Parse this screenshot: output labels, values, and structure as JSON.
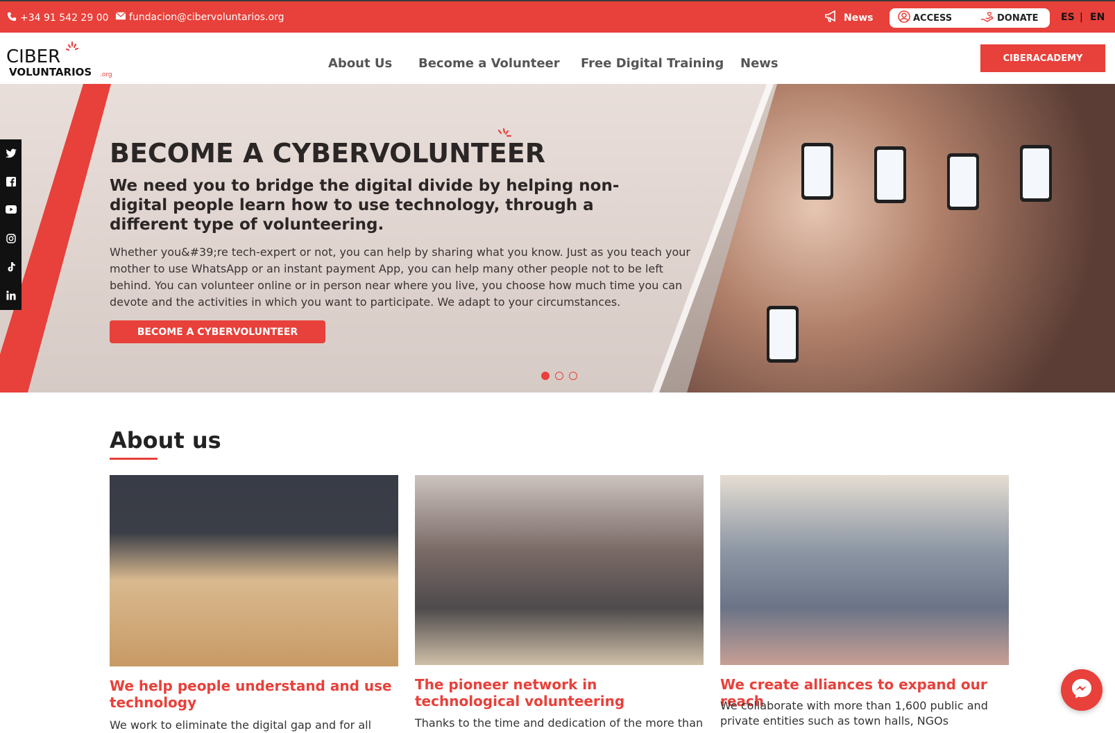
{
  "topbar": {
    "phone": "+34 91 542 29 00",
    "email": "fundacion@cibervoluntarios.org",
    "news": "News",
    "access": "ACCESS",
    "donate": "DONATE",
    "lang_es": "ES",
    "lang_sep": "|",
    "lang_en": "EN"
  },
  "logo": {
    "line1": "CIBER",
    "line2": "VOLUNTARIOS",
    "suffix": ".org"
  },
  "nav": {
    "about": "About Us",
    "volunteer": "Become a Volunteer",
    "training": "Free Digital Training",
    "news": "News",
    "academy": "CIBERACADEMY"
  },
  "hero": {
    "title": "BECOME A CYBERVOLUNTEER",
    "subtitle": "We need you to bridge the digital divide by helping non-digital people learn how to use technology, through a different type of volunteering.",
    "body": "Whether you&#39;re tech-expert or not, you can help by sharing what you know. Just as you teach your mother to use WhatsApp or an instant payment App, you can help many other people not to be left behind. You can volunteer online or in person near where you live, you choose how much time you can devote and the activities in which you want to participate. We adapt to your circumstances.",
    "button": "BECOME A CYBERVOLUNTEER",
    "slides": 3,
    "active_slide": 1
  },
  "social": [
    "twitter-icon",
    "facebook-icon",
    "youtube-icon",
    "instagram-icon",
    "tiktok-icon",
    "linkedin-icon"
  ],
  "about": {
    "title": "About us",
    "cards": [
      {
        "title": "We help people understand and use technology",
        "text": "We work to eliminate the digital gap and for all"
      },
      {
        "title": "The pioneer network in technological volunteering",
        "text": "Thanks to the time and dedication of the more than"
      },
      {
        "title": "We create alliances to expand our reach",
        "text": "We collaborate with more than 1,600 public and private entities such as town halls, NGOs"
      }
    ]
  },
  "colors": {
    "accent": "#e8403a",
    "dark": "#2b2626"
  }
}
